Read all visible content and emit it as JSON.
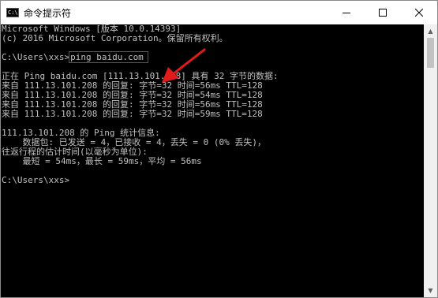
{
  "window": {
    "title": "命令提示符",
    "icon_text": "C:\\",
    "controls": [
      "minimize",
      "maximize",
      "close"
    ]
  },
  "console": {
    "lines": [
      "Microsoft Windows [版本 10.0.14393]",
      "(c) 2016 Microsoft Corporation。保留所有权利。",
      "",
      "C:\\Users\\xxs>",
      "",
      "正在 Ping baidu.com [111.13.101.208] 具有 32 字节的数据:",
      "来自 111.13.101.208 的回复: 字节=32 时间=56ms TTL=128",
      "来自 111.13.101.208 的回复: 字节=32 时间=54ms TTL=128",
      "来自 111.13.101.208 的回复: 字节=32 时间=56ms TTL=128",
      "来自 111.13.101.208 的回复: 字节=32 时间=59ms TTL=128",
      "",
      "111.13.101.208 的 Ping 统计信息:",
      "    数据包: 已发送 = 4，已接收 = 4，丢失 = 0 (0% 丢失)，",
      "往返行程的估计时间(以毫秒为单位):",
      "    最短 = 54ms，最长 = 59ms，平均 = 56ms",
      "",
      "C:\\Users\\xxs>"
    ],
    "typed_command": "ping baidu.com"
  },
  "colors": {
    "console_bg": "#000000",
    "console_text": "#c0c0c0",
    "highlight_box": "#e21a1a",
    "annotation_arrow": "#e21a1a"
  }
}
